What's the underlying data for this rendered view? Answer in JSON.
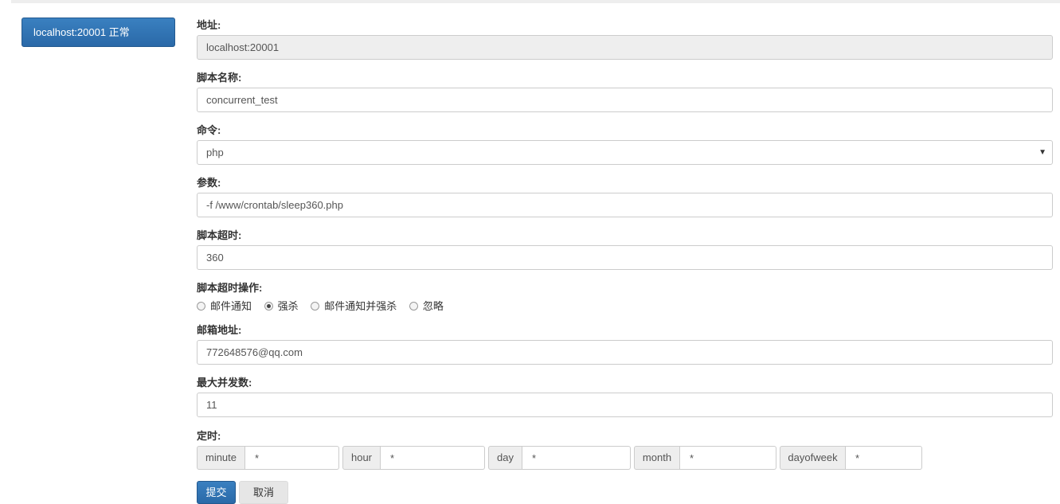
{
  "sidebar": {
    "server_label": "localhost:20001 正常"
  },
  "form": {
    "address": {
      "label": "地址:",
      "value": "localhost:20001"
    },
    "script_name": {
      "label": "脚本名称:",
      "value": "concurrent_test"
    },
    "command": {
      "label": "命令:",
      "selected": "php"
    },
    "params": {
      "label": "参数:",
      "value": "-f /www/crontab/sleep360.php"
    },
    "timeout": {
      "label": "脚本超时:",
      "value": "360"
    },
    "timeout_action": {
      "label": "脚本超时操作:",
      "options": [
        "邮件通知",
        "强杀",
        "邮件通知并强杀",
        "忽略"
      ],
      "selected": "强杀"
    },
    "email": {
      "label": "邮箱地址:",
      "value": "772648576@qq.com"
    },
    "max_concurrency": {
      "label": "最大并发数:",
      "value": "11"
    },
    "schedule": {
      "label": "定时:",
      "fields": [
        {
          "name": "minute",
          "value": "*"
        },
        {
          "name": "hour",
          "value": "*"
        },
        {
          "name": "day",
          "value": "*"
        },
        {
          "name": "month",
          "value": "*"
        },
        {
          "name": "dayofweek",
          "value": "*"
        }
      ]
    }
  },
  "buttons": {
    "submit": "提交",
    "cancel": "取消"
  }
}
